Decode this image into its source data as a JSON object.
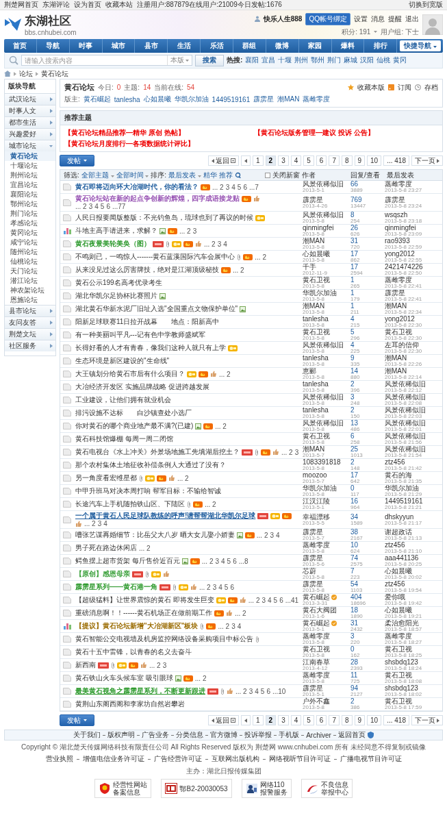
{
  "topbar": {
    "links": [
      "荆楚网首页",
      "东湖评论",
      "设为首页",
      "收藏本站"
    ],
    "stats": "注册用户:887879在线用户:21009今日发帖:1676",
    "switch": "切换到宽版"
  },
  "header": {
    "logo": "东湖社区",
    "logo_url": "bbs.cnhubei.com",
    "user": "快乐人生888",
    "qq": "QQ帐号绑定",
    "user_links": [
      "设置",
      "消息",
      "提醒",
      "退出"
    ],
    "points": "积分: 191",
    "group": "用户组: 下士"
  },
  "nav": {
    "items": [
      "首页",
      "导航",
      "时事",
      "城市",
      "县市",
      "生活",
      "乐活",
      "群组",
      "微博",
      "家园",
      "爆料",
      "排行"
    ],
    "quick": "快捷导航"
  },
  "search": {
    "placeholder": "请输入搜索内容",
    "scope": "本版",
    "button": "搜索",
    "hot_label": "热搜:",
    "hot": [
      "襄阳",
      "宜昌",
      "十堰",
      "荆州",
      "鄂州",
      "荆门",
      "麻城",
      "汉阳",
      "仙桃",
      "黄冈"
    ]
  },
  "breadcrumb": [
    "论坛",
    "黄石论坛"
  ],
  "sidebar": {
    "title": "版块导航",
    "groups": [
      {
        "label": "武汉论坛",
        "expanded": false
      },
      {
        "label": "时事人文",
        "expanded": false
      },
      {
        "label": "都市生活",
        "expanded": false
      },
      {
        "label": "兴趣爱好",
        "expanded": false
      },
      {
        "label": "城市论坛",
        "expanded": true,
        "children": [
          {
            "label": "黄石论坛",
            "selected": true
          },
          {
            "label": "十堰论坛",
            "selected": false
          },
          {
            "label": "荆州论坛",
            "selected": false
          },
          {
            "label": "宜昌论坛",
            "selected": false
          },
          {
            "label": "襄阳论坛",
            "selected": false
          },
          {
            "label": "鄂州论坛",
            "selected": false
          },
          {
            "label": "荆门论坛",
            "selected": false
          },
          {
            "label": "孝感论坛",
            "selected": false
          },
          {
            "label": "黄冈论坛",
            "selected": false
          },
          {
            "label": "咸宁论坛",
            "selected": false
          },
          {
            "label": "随州论坛",
            "selected": false
          },
          {
            "label": "仙桃论坛",
            "selected": false
          },
          {
            "label": "天门论坛",
            "selected": false
          },
          {
            "label": "潜江论坛",
            "selected": false
          },
          {
            "label": "神农架论坛",
            "selected": false
          },
          {
            "label": "恩施论坛",
            "selected": false
          }
        ]
      },
      {
        "label": "县市论坛",
        "expanded": false
      },
      {
        "label": "友问友答",
        "expanded": false
      },
      {
        "label": "荆楚文坛",
        "expanded": false
      },
      {
        "label": "社区服务",
        "expanded": false
      }
    ]
  },
  "forum": {
    "title": "黄石论坛",
    "stats": [
      {
        "label": "今日:",
        "value": "0"
      },
      {
        "label": "主题:",
        "value": "14"
      },
      {
        "label": "当前在线:",
        "value": "54"
      }
    ],
    "actions": [
      "收藏本版",
      "订阅",
      "存档"
    ],
    "moderators_label": "版主:",
    "moderators": [
      "黄石崛起",
      "tanlesha",
      "心如晨曦",
      "华凯尔加油",
      "1449519161",
      "霹雳星",
      "潮MAN",
      "蒸雌零度"
    ]
  },
  "recommended": {
    "title": "推荐主题",
    "links": [
      "【黄石论坛精品推荐—精华 原创 热帖】",
      "【黄石论坛版务管理—建议 投诉 公告】",
      "【黄石论坛月度排行—各项数据统计评比】"
    ]
  },
  "pager_top": {
    "post": "发帖",
    "back": "返回",
    "pages": [
      {
        "label": "1",
        "selected": false
      },
      {
        "label": "2",
        "selected": true
      },
      {
        "label": "3",
        "selected": false
      },
      {
        "label": "4",
        "selected": false
      },
      {
        "label": "5",
        "selected": false
      },
      {
        "label": "6",
        "selected": false
      },
      {
        "label": "7",
        "selected": false
      },
      {
        "label": "8",
        "selected": false
      },
      {
        "label": "9",
        "selected": false
      },
      {
        "label": "10",
        "selected": false
      },
      {
        "label": "... 418",
        "selected": false
      }
    ],
    "next": "下一页"
  },
  "filter": {
    "label": "筛选:",
    "dropdowns": [
      "全部主题",
      "全部时间"
    ],
    "sort_label": "排序:",
    "sort": "最后发表",
    "links": [
      "精华",
      "推荐"
    ],
    "close_new_window": {
      "label": "关闭新窗",
      "checked": false
    },
    "columns": [
      "作者",
      "回复/查看",
      "最后发表"
    ]
  },
  "threads": [
    {
      "kind": "topic",
      "title": "黄石即将迈向环大冶湖时代，你的看法？",
      "highlight": {
        "color": "#1f5d9e",
        "bold": true,
        "underline": false
      },
      "hot": true,
      "pages": [
        "... 2",
        "3",
        "4",
        "5",
        "6",
        "...7"
      ],
      "author": "风景依稀似旧",
      "date": "2013-5-1",
      "replies": "66",
      "views": "3889",
      "last_user": "蒸雌零度",
      "last_time": "2013-5-8 23:27"
    },
    {
      "kind": "topic",
      "title": "黄石论坛站在新的起点争创新的辉煌，四字成语接龙贴",
      "highlight": {
        "color": "#8e44ad",
        "bold": false,
        "underline": false
      },
      "hot": true,
      "liked": true,
      "pages": [
        "... 2",
        "3",
        "4",
        "5",
        "6",
        "...77"
      ],
      "author": "霹雳星",
      "date": "2013-4-26",
      "replies": "769",
      "views": "13447",
      "last_user": "霹雳星",
      "last_time": "2013-5-8 23:24"
    },
    {
      "kind": "topic",
      "title": "人民日报要闻版整版：不光钓鱼岛，琉球也到了再议的时候",
      "rated": true,
      "author": "风景依稀似旧",
      "date": "2013-5-8",
      "replies": "8",
      "views": "254",
      "last_user": "wsqszh",
      "last_time": "2013-5-8 23:18"
    },
    {
      "kind": "poll",
      "title": "斗地主高手请进来，求解？",
      "image": true,
      "hot": true,
      "pages": [
        "... 2",
        "3"
      ],
      "author": "qinmingfei",
      "date": "2013-5-8",
      "replies": "26",
      "views": "626",
      "last_user": "qinmingfei",
      "last_time": "2013-5-8 23:09"
    },
    {
      "kind": "topic",
      "title": "黄石夜景美轮美奂（图）",
      "highlight": {
        "color": "#2e9a2e",
        "bold": true,
        "underline": false
      },
      "tagged": true,
      "attachment": true,
      "rated": true,
      "hot": true,
      "liked": true,
      "pages": [
        "... 2",
        "3",
        "4"
      ],
      "author": "潮MAN",
      "date": "2013-5-8",
      "replies": "31",
      "views": "720",
      "last_user": "rao9393",
      "last_time": "2013-5-8 22:59"
    },
    {
      "kind": "topic",
      "title": "不鸣则已，一鸣惊人-------黄石蓝溪国际汽车会展中心",
      "attachment": true,
      "hot": true,
      "pages": [
        "... 2"
      ],
      "author": "心如晨曦",
      "date": "2013-5-8",
      "replies": "17",
      "views": "862",
      "last_user": "yong2012",
      "last_time": "2013-5-8 22:55"
    },
    {
      "kind": "topic",
      "title": "从来没见过这么厉害牌技，绝对是江湖顶级秘技",
      "hot": true,
      "pages": [
        "... 2"
      ],
      "author": "千手",
      "date": "2012-11-9",
      "replies": "17",
      "views": "2594",
      "last_user": "2421474226",
      "last_time": "2013-5-8 22:50"
    },
    {
      "kind": "topic",
      "title": "黄石公示199名高考优录考生",
      "author": "黄石卫视",
      "date": "2013-5-8",
      "replies": "1",
      "views": "265",
      "last_user": "蒸雌零度",
      "last_time": "2013-5-8 22:41"
    },
    {
      "kind": "topic",
      "title": "湖北华凯尔足协杯比赛照片",
      "image": true,
      "author": "华凯尔加油",
      "date": "2013-5-8",
      "replies": "1",
      "views": "179",
      "last_user": "霹雳星",
      "last_time": "2013-5-8 22:41"
    },
    {
      "kind": "topic",
      "title": "湖北黄石华新水泥厂旧址入选\"全国重点文物保护单位\"",
      "image": true,
      "author": "潮MAN",
      "date": "2013-5-8",
      "replies": "1",
      "views": "211",
      "last_user": "潮MAN",
      "last_time": "2013-5-8 22:34"
    },
    {
      "kind": "topic",
      "title": "阳新足球联赛11日拉开战幕　　地点：阳新高中",
      "author": "tanlesha",
      "date": "2013-5-8",
      "replies": "4",
      "views": "215",
      "last_user": "yong2012",
      "last_time": "2013-5-8 22:30"
    },
    {
      "kind": "topic",
      "title": "有一种美丽叫平凡---记有色中学教师盛斌军",
      "author": "黄石卫视",
      "date": "2013-5-8",
      "replies": "5",
      "views": "296",
      "last_user": "黄石卫视",
      "last_time": "2013-5-8 22:30"
    },
    {
      "kind": "topic",
      "title": "长得好看的人才有青春，像我们这种人就只有上学",
      "rated": true,
      "author": "风景依稀似旧",
      "date": "2013-5-8",
      "replies": "4",
      "views": "225",
      "last_user": "左耳的信仰",
      "last_time": "2013-5-8 22:30"
    },
    {
      "kind": "topic",
      "title": "生态环境是新区建设的\"生命线\"",
      "author": "tanlesha",
      "date": "2013-5-8",
      "replies": "9",
      "views": "335",
      "last_user": "潮MAN",
      "last_time": "2013-5-8 22:26"
    },
    {
      "kind": "topic",
      "title": "大王镇划分给黄石市后有什么项目？",
      "rated": true,
      "hot": true,
      "liked": true,
      "pages": [
        "... 2"
      ],
      "author": "恵郦",
      "date": "2013-5-8",
      "replies": "14",
      "views": "880",
      "last_user": "潮MAN",
      "last_time": "2013-5-8 22:14"
    },
    {
      "kind": "topic",
      "title": "大冶经济开发区 实施品牌战略 促进跨越发展",
      "author": "tanlesha",
      "date": "2013-5-8",
      "replies": "2",
      "views": "396",
      "last_user": "风景依稀似旧",
      "last_time": "2013-5-8 22:12"
    },
    {
      "kind": "topic",
      "title": "工业建设，让他们拥有就业机会",
      "author": "风景依稀似旧",
      "date": "2013-5-8",
      "replies": "3",
      "views": "248",
      "last_user": "风景依稀似旧",
      "last_time": "2013-5-8 22:08"
    },
    {
      "kind": "topic",
      "title": "排污设施不达标　　白沙镇查处小选厂",
      "author": "tanlesha",
      "date": "2013-5-8",
      "replies": "2",
      "views": "150",
      "last_user": "风景依稀似旧",
      "last_time": "2013-5-8 22:03"
    },
    {
      "kind": "topic",
      "title": "你对黄石的哪个商业地产最不满?(已建)",
      "image": true,
      "hot": true,
      "pages": [
        "... 2"
      ],
      "author": "风景依稀似旧",
      "date": "2013-5-8",
      "replies": "13",
      "views": "486",
      "last_user": "风景依稀似旧",
      "last_time": "2013-5-8 22:01"
    },
    {
      "kind": "topic",
      "title": "黄石科技馆爆棚 每周一周二闭馆",
      "author": "黄石卫视",
      "date": "2013-5-8",
      "replies": "6",
      "views": "258",
      "last_user": "风景依稀似旧",
      "last_time": "2013-5-8 21:56"
    },
    {
      "kind": "topic",
      "title": "黄石电视台《水上冲关》外景场地施工先填湖后挖土？",
      "tagged": true,
      "attachment": true,
      "hot": true,
      "liked": true,
      "pages": [
        "... 2",
        "3"
      ],
      "author": "潮MAN",
      "date": "2013-5-7",
      "replies": "25",
      "views": "1013",
      "last_user": "风景依稀似旧",
      "last_time": "2013-5-8 21:54"
    },
    {
      "kind": "topic",
      "title": "那个农村集体土地征收补偿条例人大通过了没有？",
      "author": "1083391818",
      "date": "2013-5-8",
      "replies": "2",
      "views": "148",
      "last_user": "ztz456",
      "last_time": "2013-5-8 21:42"
    },
    {
      "kind": "topic",
      "title": "另一角度看宏维星都",
      "attachment": true,
      "rated": true,
      "hot": true,
      "liked": true,
      "pages": [
        "... 2"
      ],
      "author": "moozoo",
      "date": "2013-5-7",
      "replies": "17",
      "views": "642",
      "last_user": "黄石的海",
      "last_time": "2013-5-8 21:35"
    },
    {
      "kind": "topic",
      "title": "中甲升班马对决本周打响 帮军目标：不输给智诚",
      "author": "华凯尔加油",
      "date": "2013-5-8",
      "replies": "0",
      "views": "117",
      "last_user": "华凯尔加油",
      "last_time": "2013-5-8 21:29"
    },
    {
      "kind": "topic",
      "title": "长途汽车上手机随拍铁山区、下陆区",
      "attachment": true,
      "hot": true,
      "pages": [
        "... 2"
      ],
      "author": "江汉江陵",
      "date": "2013-5-1",
      "replies": "16",
      "views": "964",
      "last_user": "1449519161",
      "last_time": "2013-5-8 21:21"
    },
    {
      "kind": "topic",
      "title": "一个属于黄石人民足球队教练的呼声!请帮帮湖北华凯尔足球",
      "highlight": {
        "color": "#1f5d9e",
        "bold": true,
        "underline": true
      },
      "tagged": true,
      "rated": true,
      "hot": true,
      "liked": true,
      "pages": [
        "... 2",
        "3",
        "4"
      ],
      "author": "幸福漂移",
      "date": "2013-5-5",
      "replies": "34",
      "views": "1589",
      "last_user": "dhskyyun",
      "last_time": "2013-5-8 21:17"
    },
    {
      "kind": "topic",
      "title": "嘈张艺谋再婚细节：比岳父大八岁 晒大女儿娶小娇妻",
      "image": true,
      "hot": true,
      "pages": [
        "... 2",
        "3",
        "4"
      ],
      "author": "霹雳星",
      "date": "2013-5-7",
      "replies": "38",
      "views": "2167",
      "last_user": "谢超政话",
      "last_time": "2013-5-8 21:13"
    },
    {
      "kind": "topic",
      "title": "男子死在路边休闲店",
      "pages": [
        "... 2"
      ],
      "author": "蒸雌零度",
      "date": "2013-5-8",
      "replies": "10",
      "views": "624",
      "last_user": "ztz456",
      "last_time": "2013-5-8 21:10"
    },
    {
      "kind": "topic",
      "title": "鳄鱼摆上超市货架 每斤售价近百元",
      "image": true,
      "hot": true,
      "pages": [
        "... 2",
        "3",
        "4",
        "5",
        "6",
        "...8"
      ],
      "author": "霹雳星",
      "date": "2013-5-6",
      "replies": "74",
      "views": "2575",
      "last_user": "aaa441136",
      "last_time": "2013-5-8 20:25"
    },
    {
      "kind": "topic",
      "title": "【原创】感恩母亲",
      "highlight": {
        "color": "#2e9a2e",
        "bold": false,
        "underline": false
      },
      "tagged": true,
      "attachment": true,
      "rated": true,
      "liked": true,
      "author": "芯蔚",
      "date": "2013-5-8",
      "replies": "7",
      "views": "223",
      "last_user": "心如晨曦",
      "last_time": "2013-5-8 20:02"
    },
    {
      "kind": "topic",
      "title": "霹雳星系列——黄石港一角",
      "highlight": {
        "color": "#2e9a2e",
        "bold": true,
        "underline": false
      },
      "tagged": true,
      "attachment": true,
      "rated": true,
      "liked": true,
      "pages": [
        "... 2",
        "3",
        "4",
        "5",
        "6"
      ],
      "author": "霹雳星",
      "date": "2013-5-8",
      "replies": "54",
      "views": "1103",
      "last_user": "ztz456",
      "last_time": "2013-5-8 19:54"
    },
    {
      "kind": "topic",
      "title": "【超级猛料】让世界震惊的黄石 即将发生巨变",
      "rated": true,
      "hot": true,
      "liked": true,
      "pages": [
        "... 2",
        "3",
        "4",
        "5",
        "6",
        "...41"
      ],
      "author": "黄石崛起",
      "verified": true,
      "date": "2013-3-31",
      "replies": "404",
      "views": "18696",
      "last_user": "爱你哦",
      "last_time": "2013-5-8 19:42"
    },
    {
      "kind": "topic",
      "title": "重磅消息啊！！------黄石机场正在做前期工作",
      "hot": true,
      "liked": true,
      "pages": [
        "... 2"
      ],
      "author": "黄石大阀团",
      "date": "2013-1-6",
      "replies": "18",
      "views": "1890",
      "last_user": "心如晨曦",
      "last_time": "2013-5-8 19:21"
    },
    {
      "kind": "poll",
      "title": "【提议】黄石论坛新增\"大冶湖新区\"板块",
      "highlight": {
        "color": "#9a6b00",
        "bold": true,
        "underline": false
      },
      "attachment": true,
      "hot": true,
      "pages": [
        "... 2",
        "3",
        "4"
      ],
      "author": "黄石崛起",
      "verified": true,
      "date": "2013-5-1",
      "replies": "31",
      "views": "2432",
      "last_user": "柔治愈阳光",
      "last_time": "2013-5-8 18:57"
    },
    {
      "kind": "topic",
      "title": "黄石智能公交电视墙及机房监控网络设备采购项目中标公告",
      "attachment": true,
      "author": "蒸雌零度",
      "date": "2013-5-8",
      "replies": "3",
      "views": "220",
      "last_user": "蒸雌零度",
      "last_time": "2013-5-8 18:27"
    },
    {
      "kind": "topic",
      "title": "黄石十五中雷锋，以青春的名义去奋斗",
      "author": "黄石卫视",
      "date": "2013-5-8",
      "replies": "0",
      "views": "162",
      "last_user": "黄石卫视",
      "last_time": "2013-5-8 18:25"
    },
    {
      "kind": "topic",
      "title": "新西南",
      "tagged": true,
      "attachment": true,
      "rated": true,
      "hot": true,
      "liked": true,
      "pages": [
        "... 2",
        "3"
      ],
      "author": "江南春草",
      "date": "2013-4-12",
      "replies": "28",
      "views": "2393",
      "last_user": "shsbdq123",
      "last_time": "2013-5-8 18:24"
    },
    {
      "kind": "topic",
      "title": "黄石铁山火车头候车室 吸引眼球",
      "image": true,
      "hot": true,
      "pages": [
        "... 2"
      ],
      "author": "蒸雌零度",
      "date": "2013-5-8",
      "replies": "11",
      "views": "725",
      "last_user": "黄石卫视",
      "last_time": "2013-5-8 18:08"
    },
    {
      "kind": "topic",
      "title": "最美黄石视角之霹雳星系列，不断更新跟进",
      "highlight": {
        "color": "#2e9a2e",
        "bold": true,
        "underline": true
      },
      "tagged": true,
      "attachment": true,
      "liked": true,
      "pages": [
        "... 2",
        "3",
        "4",
        "5",
        "6",
        "...10"
      ],
      "author": "霹雳星",
      "date": "2013-5-1",
      "replies": "94",
      "views": "2127",
      "last_user": "shsbdq123",
      "last_time": "2013-5-8 18:02"
    },
    {
      "kind": "topic",
      "title": "黄荆山东阁西阁和李家坊自然岩攀岩",
      "author": "户外不鑫",
      "date": "2013-5-8",
      "replies": "2",
      "views": "386",
      "last_user": "黄石卫视",
      "last_time": "2013-5-8 17:59"
    }
  ],
  "pager_bottom": {
    "post": "发帖",
    "back": "返回",
    "pages": [
      {
        "label": "1",
        "selected": false
      },
      {
        "label": "2",
        "selected": true
      },
      {
        "label": "3",
        "selected": false
      },
      {
        "label": "4",
        "selected": false
      },
      {
        "label": "5",
        "selected": false
      },
      {
        "label": "6",
        "selected": false
      },
      {
        "label": "7",
        "selected": false
      },
      {
        "label": "8",
        "selected": false
      },
      {
        "label": "9",
        "selected": false
      },
      {
        "label": "10",
        "selected": false
      },
      {
        "label": "... 418",
        "selected": false
      }
    ],
    "next": "下一页"
  },
  "footer": {
    "links": [
      "关于我们",
      "版权声明",
      "广告业务",
      "分类信息",
      "官方微博",
      "投诉举报",
      "手机版",
      "Archiver",
      "返回首页"
    ],
    "copyright": "Copyright © 湖北楚天传媒网络科技有限责任公司 All Rights Reserved 版权为 荆楚网 www.cnhubei.com 所有 未经同意不得复制或镜像",
    "licenses": [
      "营业执照",
      "增值电信业务许可证",
      "广告经营许可证",
      "互联网出版机构",
      "网络视听节目许可证",
      "广播电视节目许可证"
    ],
    "host": "主办：湖北日报传媒集团",
    "badges": [
      {
        "kind": "emblem",
        "lines": [
          "经营性网站",
          "备案信息"
        ]
      },
      {
        "kind": "ecp",
        "lines": [
          "鄂B2-20030053"
        ]
      },
      {
        "kind": "police",
        "lines": [
          "网络110",
          "报警服务"
        ]
      },
      {
        "kind": "report",
        "lines": [
          "不良信息",
          "举报中心"
        ]
      }
    ]
  }
}
